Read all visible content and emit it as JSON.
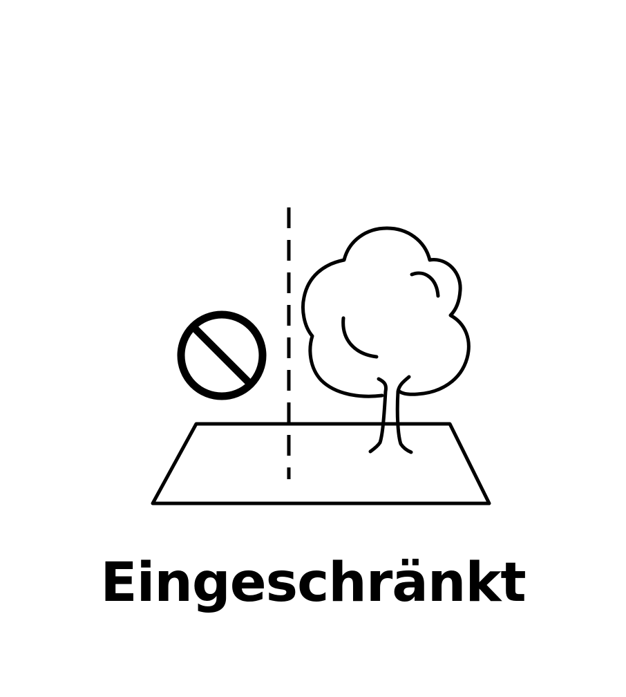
{
  "caption": {
    "label": "Eingeschränkt"
  },
  "pictogram": {
    "icons": [
      "prohibited-icon",
      "boundary-line-icon",
      "tree-icon",
      "ground-plot-icon"
    ],
    "stroke_color": "#000000",
    "background_color": "#ffffff"
  }
}
